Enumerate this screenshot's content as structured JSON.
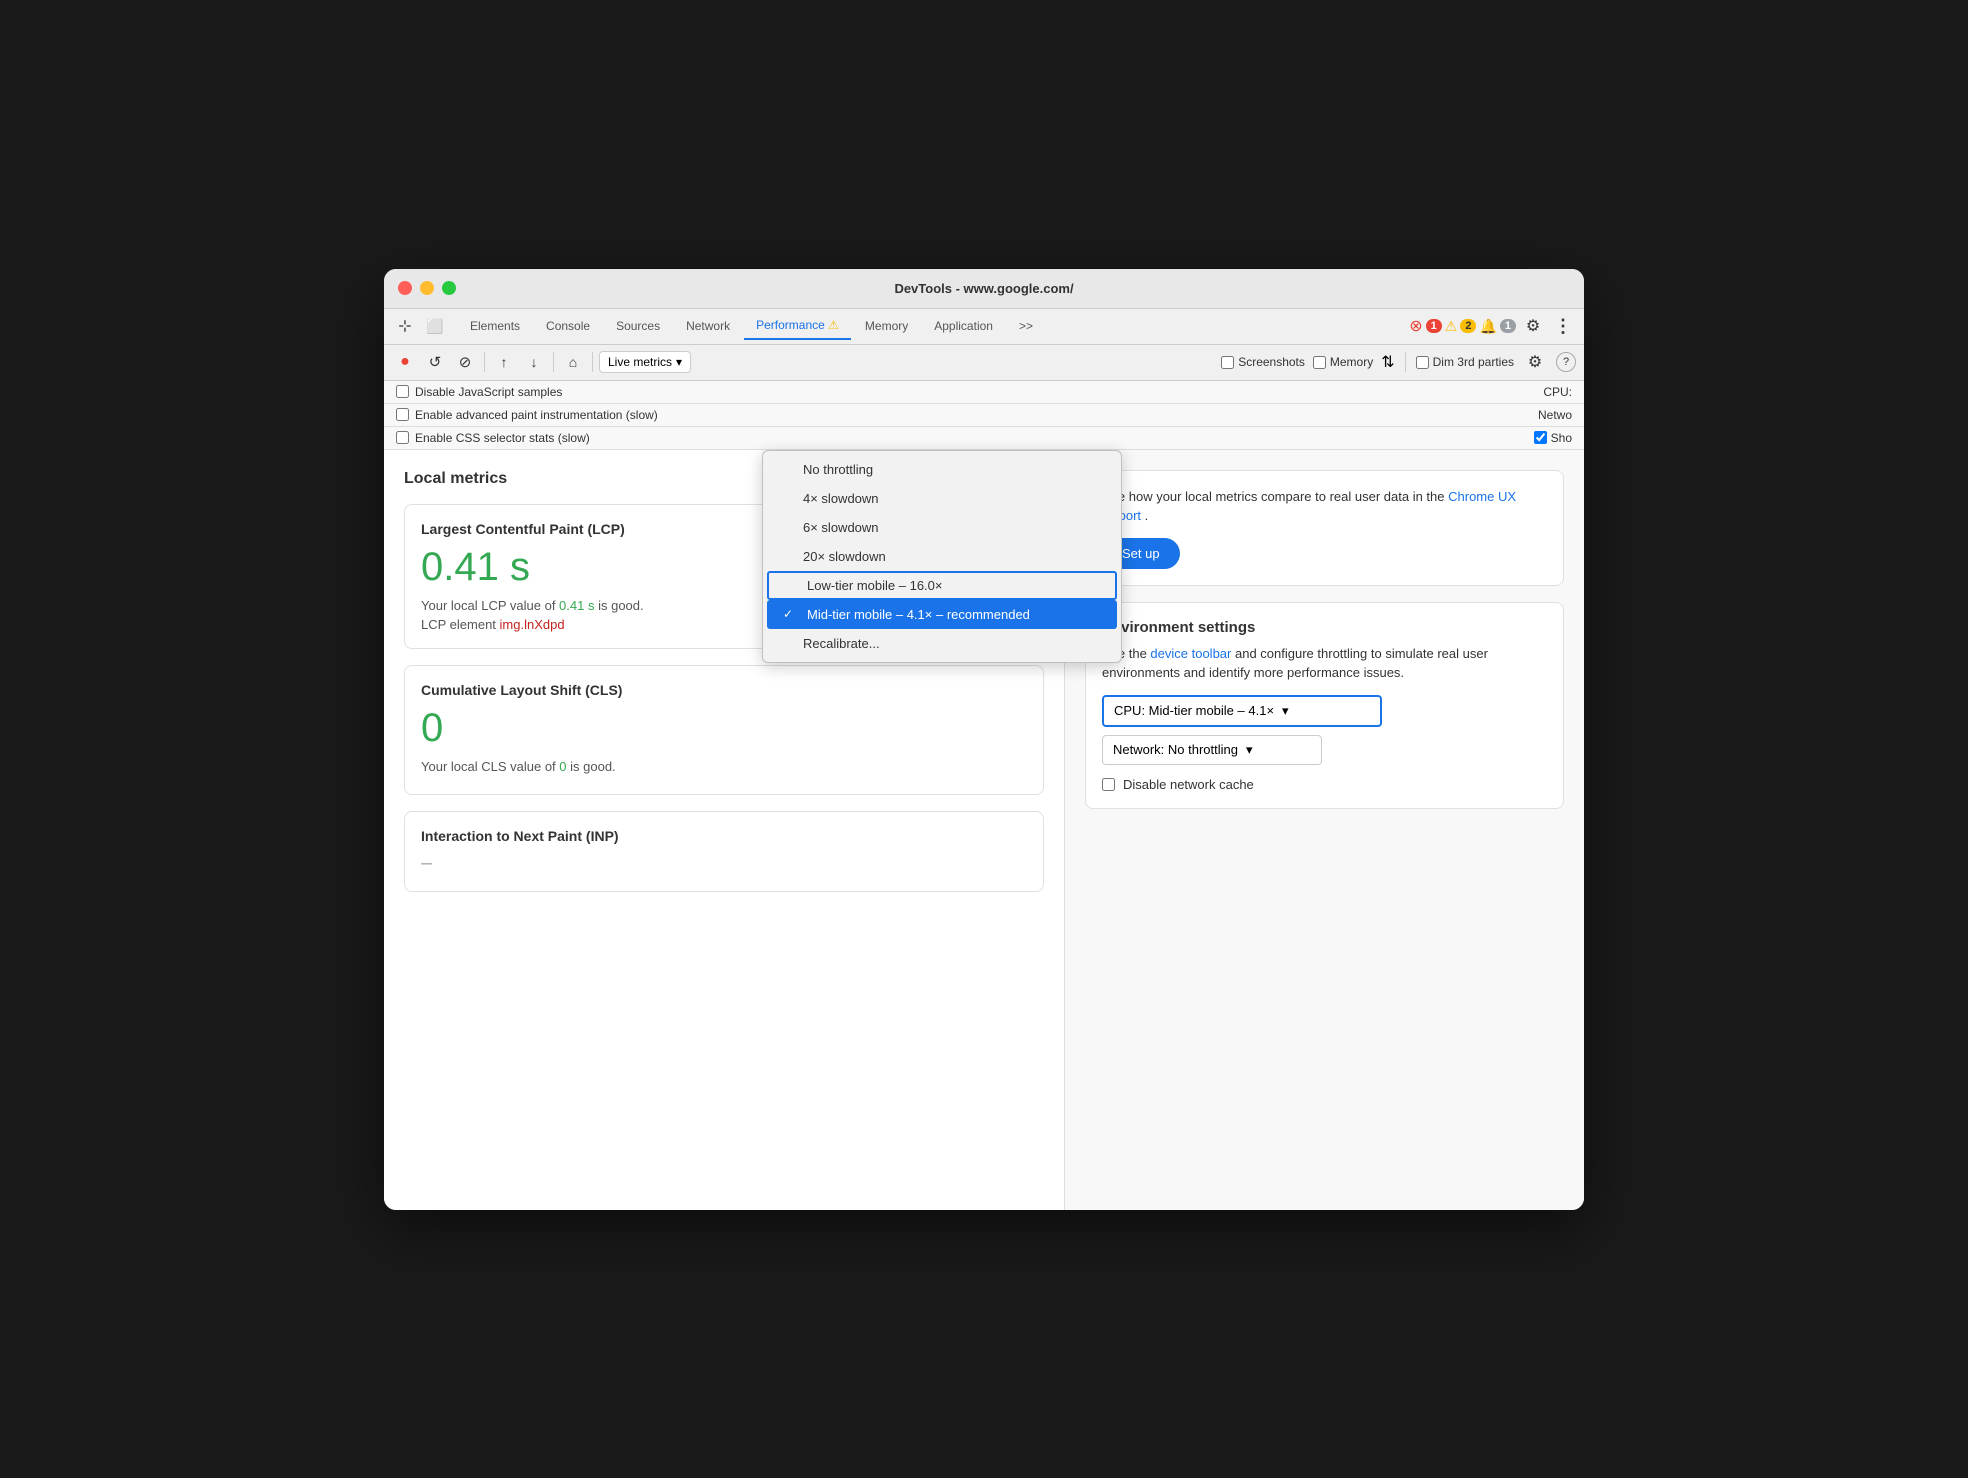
{
  "window": {
    "title": "DevTools - www.google.com/"
  },
  "tabs": [
    {
      "id": "elements",
      "label": "Elements",
      "active": false
    },
    {
      "id": "console",
      "label": "Console",
      "active": false
    },
    {
      "id": "sources",
      "label": "Sources",
      "active": false
    },
    {
      "id": "network",
      "label": "Network",
      "active": false
    },
    {
      "id": "performance",
      "label": "Performance ⚠",
      "active": true
    },
    {
      "id": "memory",
      "label": "Memory",
      "active": false
    },
    {
      "id": "application",
      "label": "Application",
      "active": false
    }
  ],
  "toolbar": {
    "record_label": "●",
    "reload_label": "↺",
    "clear_label": "⊘",
    "upload_label": "↑",
    "download_label": "↓",
    "home_label": "⌂",
    "live_metrics_label": "Live metrics",
    "screenshots_label": "Screenshots",
    "memory_label": "Memory",
    "dim3rd_label": "Dim 3rd parties",
    "settings_label": "⚙",
    "help_label": "?"
  },
  "settings_row": {
    "disable_js_samples_label": "Disable JavaScript samples",
    "enable_paint_label": "Enable advanced paint instrumentation (slow)",
    "enable_css_label": "Enable CSS selector stats (slow)",
    "cpu_label": "CPU:",
    "network_label": "Netwo",
    "show_label": "Sho",
    "show_checked": true
  },
  "badges": {
    "error_count": "1",
    "warning_count": "2",
    "info_count": "1"
  },
  "cpu_dropdown": {
    "options": [
      {
        "id": "no_throttling",
        "label": "No throttling",
        "selected": false
      },
      {
        "id": "4x",
        "label": "4× slowdown",
        "selected": false
      },
      {
        "id": "6x",
        "label": "6× slowdown",
        "selected": false
      },
      {
        "id": "20x",
        "label": "20× slowdown",
        "selected": false
      },
      {
        "id": "low_tier",
        "label": "Low-tier mobile – 16.0×",
        "selected": false,
        "highlighted": true
      },
      {
        "id": "mid_tier",
        "label": "Mid-tier mobile – 4.1× – recommended",
        "selected": true
      },
      {
        "id": "recalibrate",
        "label": "Recalibrate...",
        "selected": false
      }
    ]
  },
  "left_panel": {
    "local_metrics_title": "Local metrics",
    "lcp_card": {
      "title": "Largest Contentful Paint (LCP)",
      "value": "0.41 s",
      "desc_prefix": "Your local LCP value of ",
      "desc_value": "0.41 s",
      "desc_suffix": " is good.",
      "element_prefix": "LCP element",
      "element_name": "img.lnXdpd"
    },
    "cls_card": {
      "title": "Cumulative Layout Shift (CLS)",
      "value": "0",
      "desc_prefix": "Your local CLS value of ",
      "desc_value": "0",
      "desc_suffix": " is good."
    },
    "inp_card": {
      "title": "Interaction to Next Paint (INP)",
      "value": "–"
    }
  },
  "right_panel": {
    "ux_report": {
      "text_prefix": "See how your local metrics compare to real user data in the ",
      "link_text": "Chrome UX Report",
      "text_suffix": ".",
      "setup_button_label": "Set up"
    },
    "env_settings": {
      "title": "Environment settings",
      "desc": "Use the ",
      "link_text": "device toolbar",
      "desc_suffix": " and configure throttling to simulate real user environments and identify more performance issues.",
      "cpu_select_label": "CPU: Mid-tier mobile – 4.1×",
      "network_select_label": "Network: No throttling",
      "disable_cache_label": "Disable network cache"
    }
  }
}
